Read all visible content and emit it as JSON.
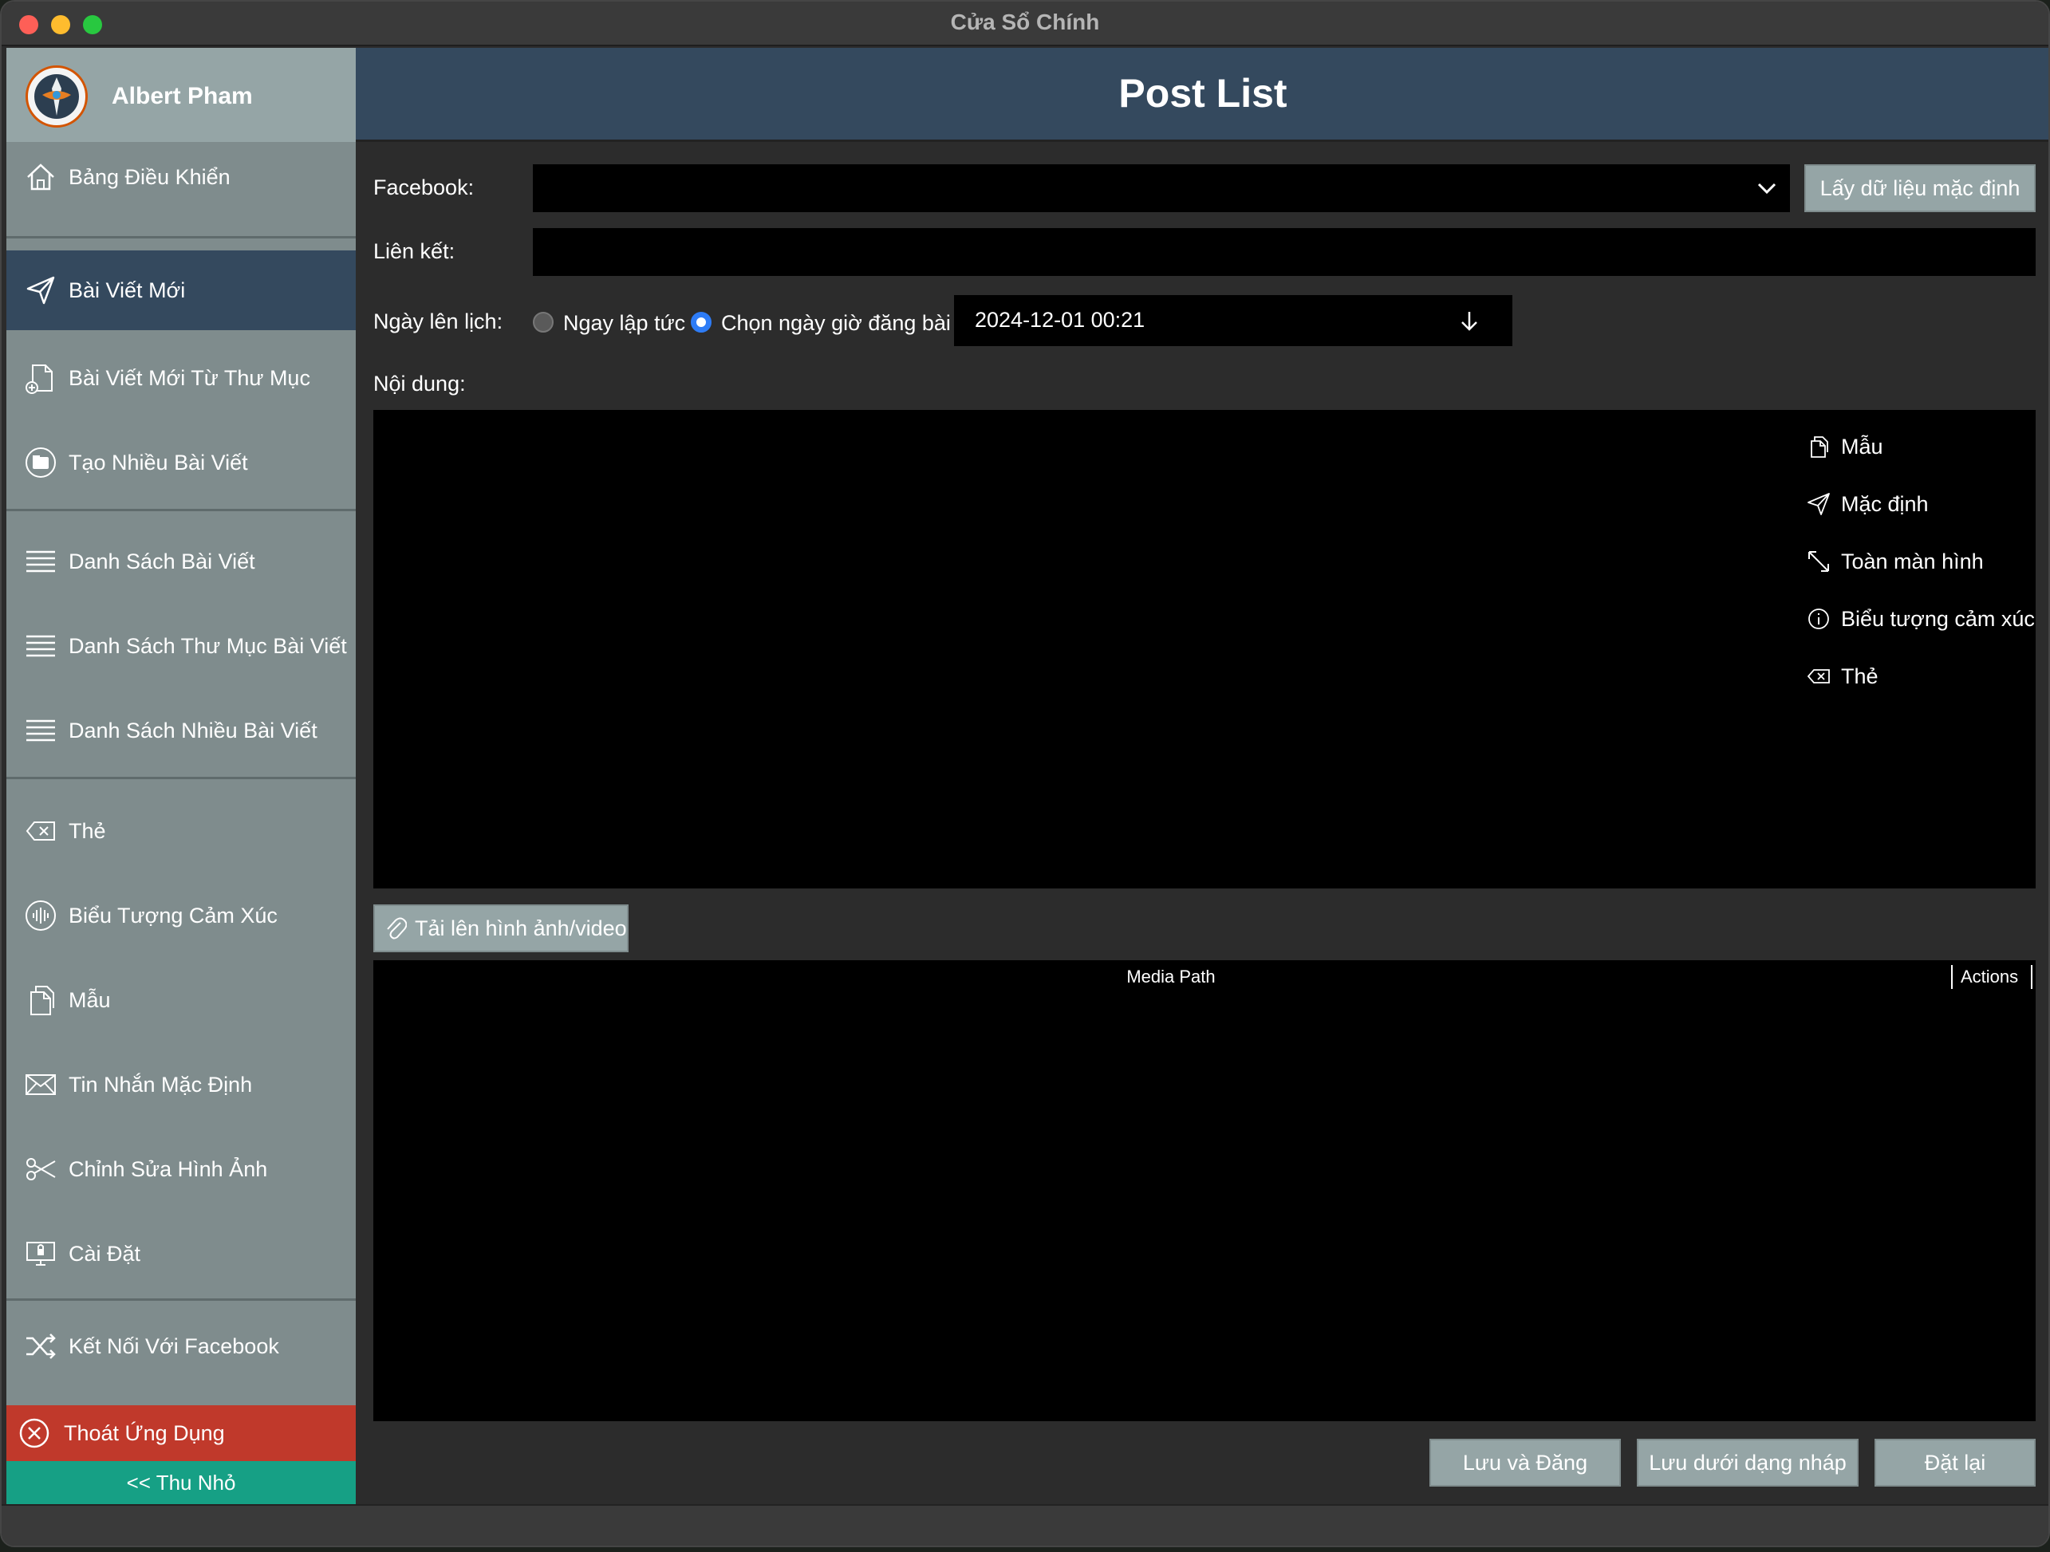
{
  "window": {
    "title": "Cửa Sổ Chính"
  },
  "sidebar": {
    "user_name": "Albert Pham",
    "items": [
      {
        "label": "Bảng Điều Khiển",
        "icon": "home-icon"
      },
      {
        "label": "Bài Viết Mới",
        "icon": "send-icon"
      },
      {
        "label": "Bài Viết Mới Từ Thư Mục",
        "icon": "file-plus-icon"
      },
      {
        "label": "Tạo Nhiều Bài Viết",
        "icon": "folder-icon"
      },
      {
        "label": "Danh Sách Bài Viết",
        "icon": "list-icon"
      },
      {
        "label": "Danh Sách Thư Mục Bài Viết",
        "icon": "list-icon"
      },
      {
        "label": "Danh Sách Nhiều Bài Viết",
        "icon": "list-icon"
      },
      {
        "label": "Thẻ",
        "icon": "tag-icon"
      },
      {
        "label": "Biểu Tượng Cảm Xúc",
        "icon": "emoji-icon"
      },
      {
        "label": "Mẫu",
        "icon": "template-icon"
      },
      {
        "label": "Tin Nhắn Mặc Định",
        "icon": "mail-icon"
      },
      {
        "label": "Chỉnh Sửa Hình Ảnh",
        "icon": "scissors-icon"
      },
      {
        "label": "Cài Đặt",
        "icon": "settings-icon"
      },
      {
        "label": "Kết Nối Với Facebook",
        "icon": "shuffle-icon"
      }
    ],
    "exit_label": "Thoát Ứng Dụng",
    "collapse_label": "<< Thu Nhỏ"
  },
  "header": {
    "title": "Post List"
  },
  "form": {
    "facebook_label": "Facebook:",
    "facebook_value": "",
    "default_data_button": "Lấy dữ liệu mặc định",
    "link_label": "Liên kết:",
    "link_value": "",
    "schedule_label": "Ngày lên lịch:",
    "radio_now": "Ngay lập tức",
    "radio_pick": "Chọn ngày giờ đăng bài",
    "datetime_value": "2024-12-01 00:21",
    "content_label": "Nội dung:",
    "content_value": ""
  },
  "content_tools": [
    {
      "label": "Mẫu",
      "icon": "template-icon"
    },
    {
      "label": "Mặc định",
      "icon": "send-icon"
    },
    {
      "label": "Toàn màn hình",
      "icon": "expand-icon"
    },
    {
      "label": "Biểu tượng cảm xúc",
      "icon": "info-icon"
    },
    {
      "label": "Thẻ",
      "icon": "tag-icon"
    }
  ],
  "media": {
    "upload_button": "Tải lên hình ảnh/video",
    "col_path": "Media Path",
    "col_actions": "Actions"
  },
  "footer": {
    "save_publish": "Lưu và Đăng",
    "save_draft": "Lưu dưới dạng nháp",
    "reset": "Đặt lại"
  },
  "colors": {
    "sidebar": "#7f8c8d",
    "active": "#34495e",
    "exit": "#c0392b",
    "collapse": "#16a085",
    "button": "#95a5a6"
  }
}
